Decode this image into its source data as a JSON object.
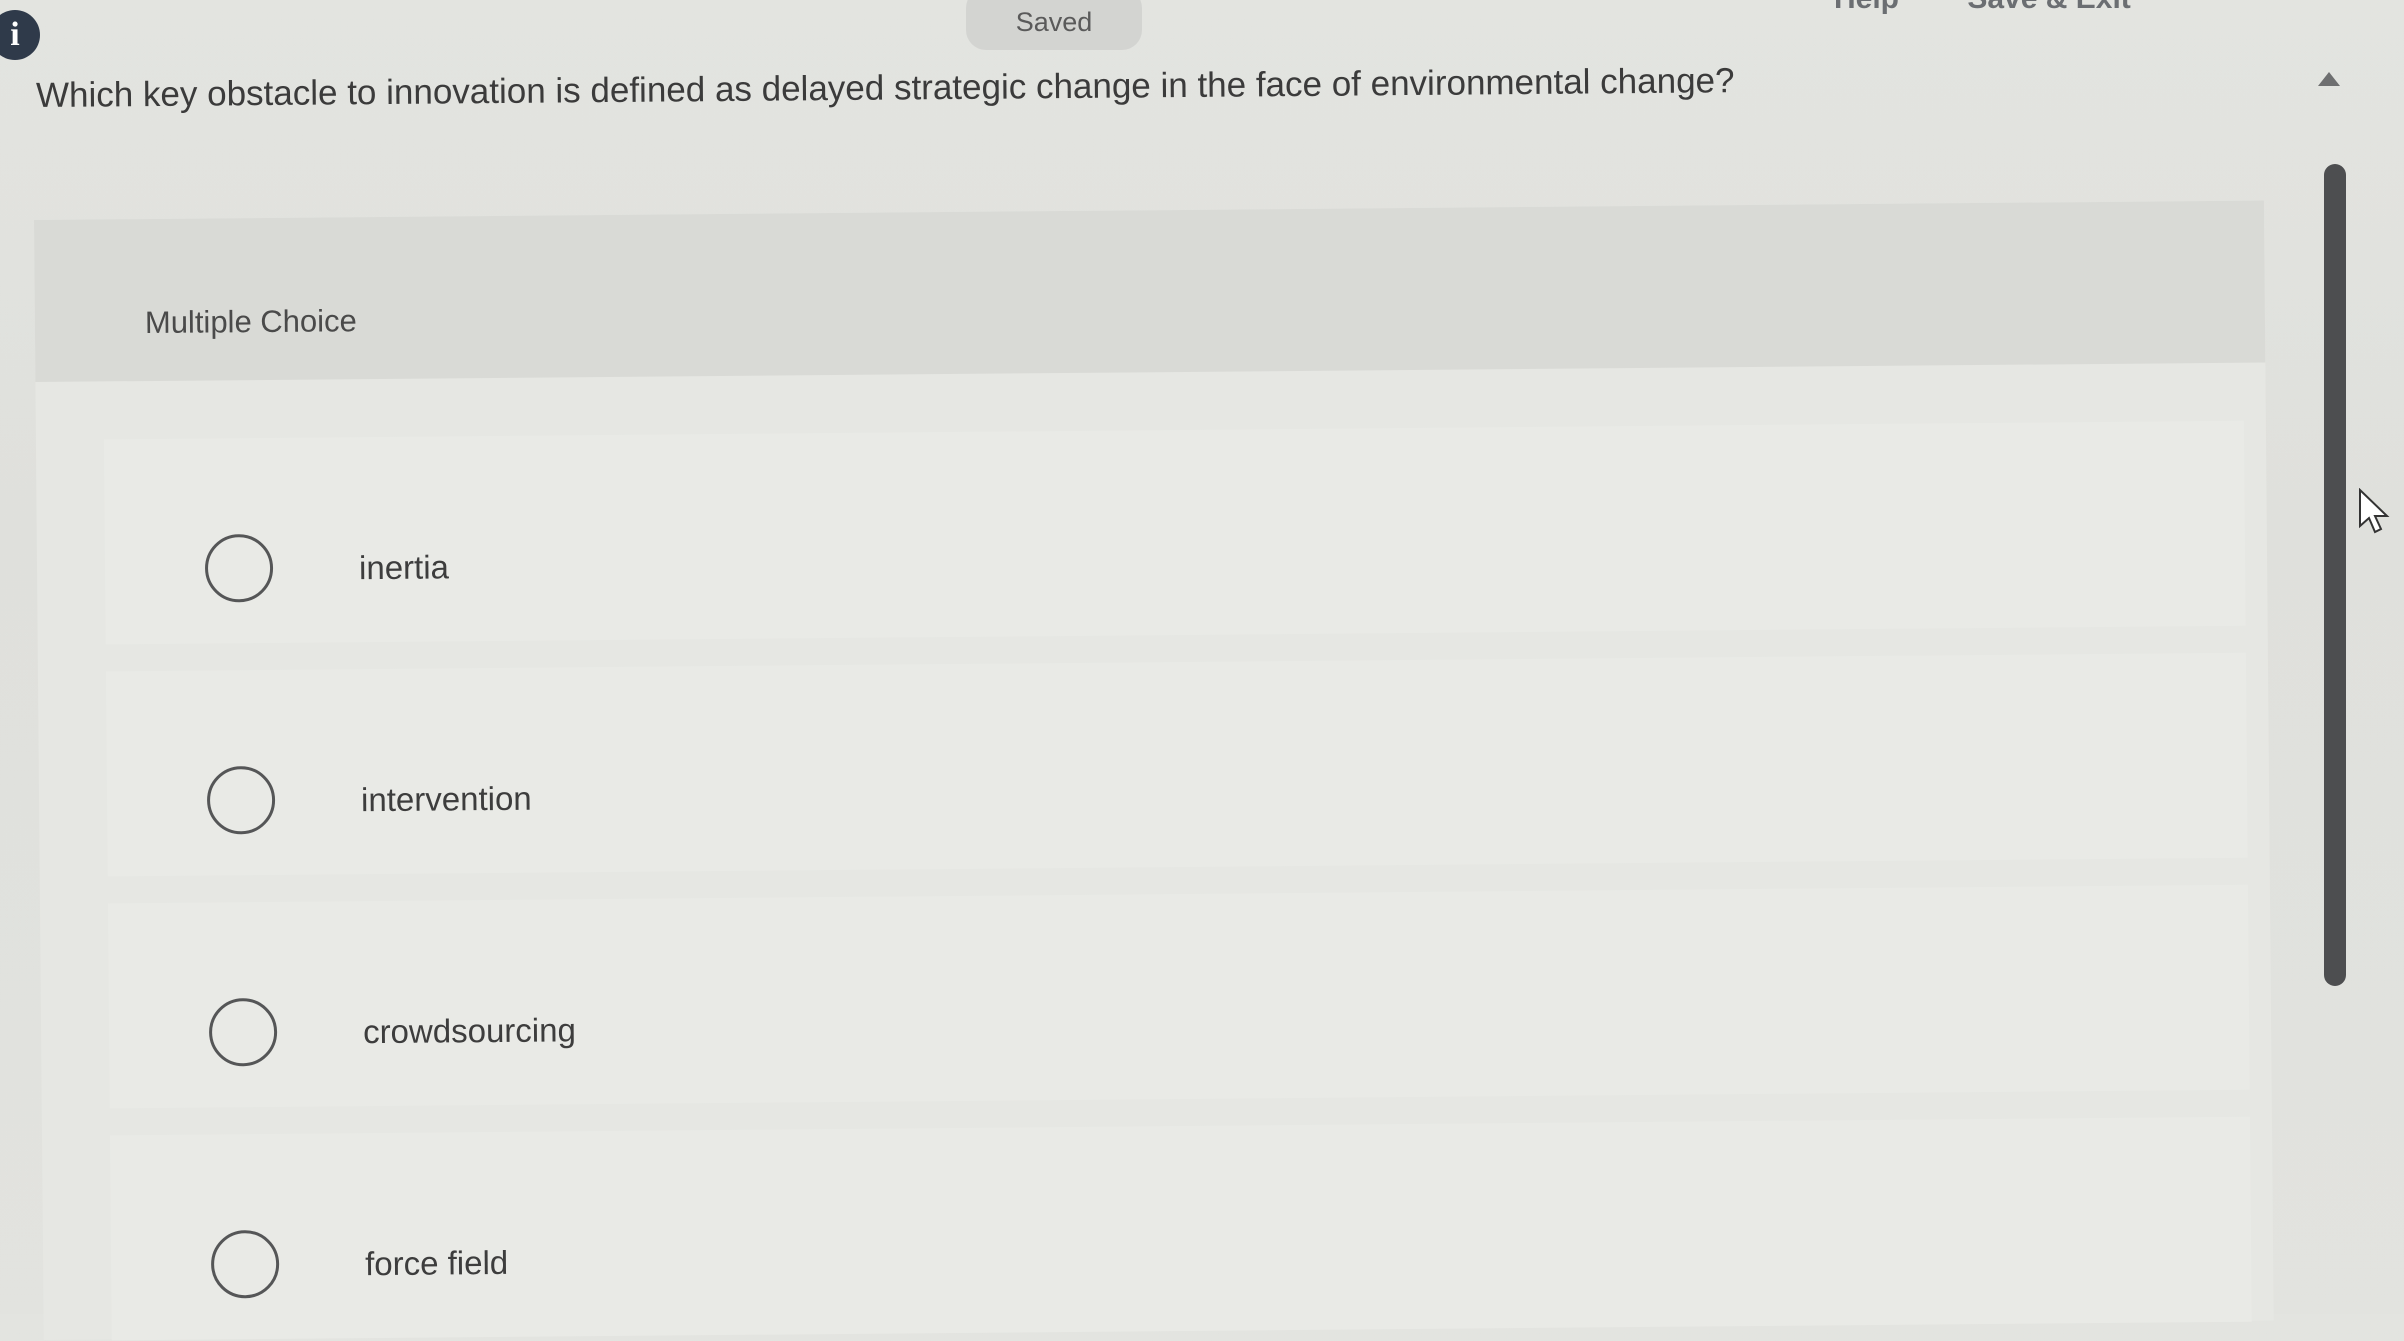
{
  "header": {
    "info_icon_glyph": "i",
    "saved_status": "Saved",
    "links": [
      "Help",
      "Save & Exit"
    ]
  },
  "question": {
    "text": "Which key obstacle to innovation is defined as delayed strategic change in the face of environmental change?",
    "type_label": "Multiple Choice",
    "options": [
      {
        "label": "inertia"
      },
      {
        "label": "intervention"
      },
      {
        "label": "crowdsourcing"
      },
      {
        "label": "force field"
      }
    ]
  },
  "icons": {
    "info": "info-icon",
    "radio": "radio-button",
    "scroll_up": "scroll-up-arrow-icon",
    "cursor": "mouse-pointer-icon"
  }
}
